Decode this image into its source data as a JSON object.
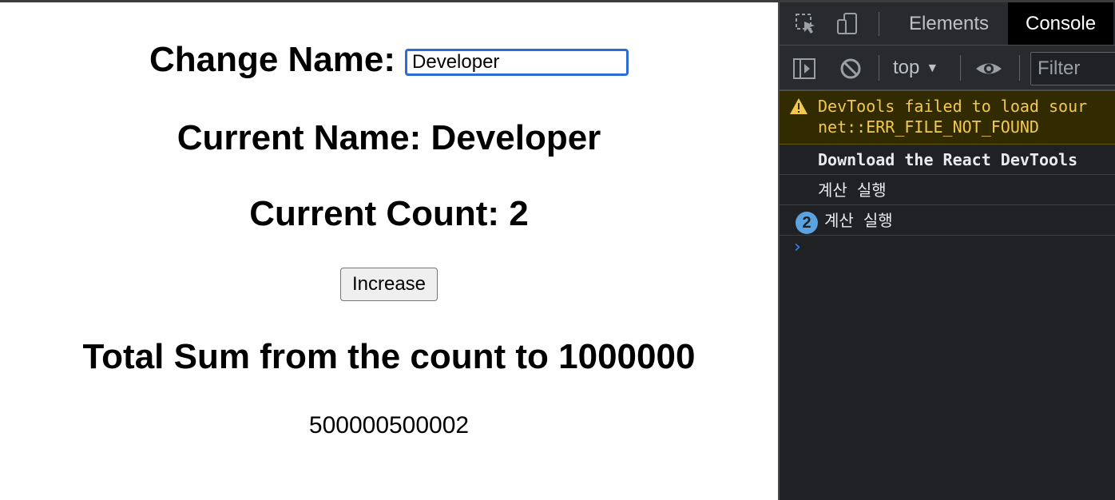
{
  "app": {
    "change_label": "Change Name:",
    "name_input_value": "Developer",
    "current_name_text": "Current Name: Developer",
    "current_count_text": "Current Count: 2",
    "increase_button": "Increase",
    "sum_heading": "Total Sum from the count to 1000000",
    "sum_value": "500000500002"
  },
  "devtools": {
    "tabs": [
      {
        "label": "Elements",
        "active": false
      },
      {
        "label": "Console",
        "active": true
      }
    ],
    "toolbar": {
      "context": "top",
      "filter_placeholder": "Filter"
    },
    "messages": [
      {
        "type": "warning",
        "line1": "DevTools failed to load sour",
        "line2": "net::ERR_FILE_NOT_FOUND"
      },
      {
        "type": "bold",
        "text": "Download the React DevTools"
      },
      {
        "type": "log",
        "text": "계산 실행"
      },
      {
        "type": "log",
        "repeat": "2",
        "text": "계산 실행"
      }
    ],
    "prompt": "›"
  },
  "colors": {
    "input_focus": "#2d6bd6",
    "devtools_bg": "#202124",
    "warning_text": "#f2c94c",
    "badge": "#5ba3e0"
  }
}
